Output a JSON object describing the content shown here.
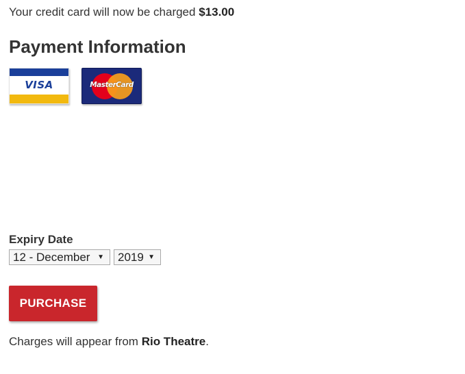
{
  "charge": {
    "prefix": "Your credit card will now be charged ",
    "amount": "$13.00"
  },
  "payment": {
    "title": "Payment Information"
  },
  "cards": {
    "visa_text": "VISA",
    "mastercard_text": "MasterCard",
    "visa_colors": {
      "blue": "#1a3f9a",
      "gold": "#f2b90f"
    },
    "mastercard_colors": {
      "background": "#1b2a7a",
      "red": "#e3001b",
      "orange": "#f79e1b"
    }
  },
  "expiry": {
    "label": "Expiry Date",
    "month_value": "12 - December",
    "year_value": "2019"
  },
  "purchase": {
    "label": "PURCHASE",
    "color": "#c9262c"
  },
  "footer": {
    "prefix": "Charges will appear from ",
    "merchant": "Rio Theatre",
    "suffix": "."
  }
}
